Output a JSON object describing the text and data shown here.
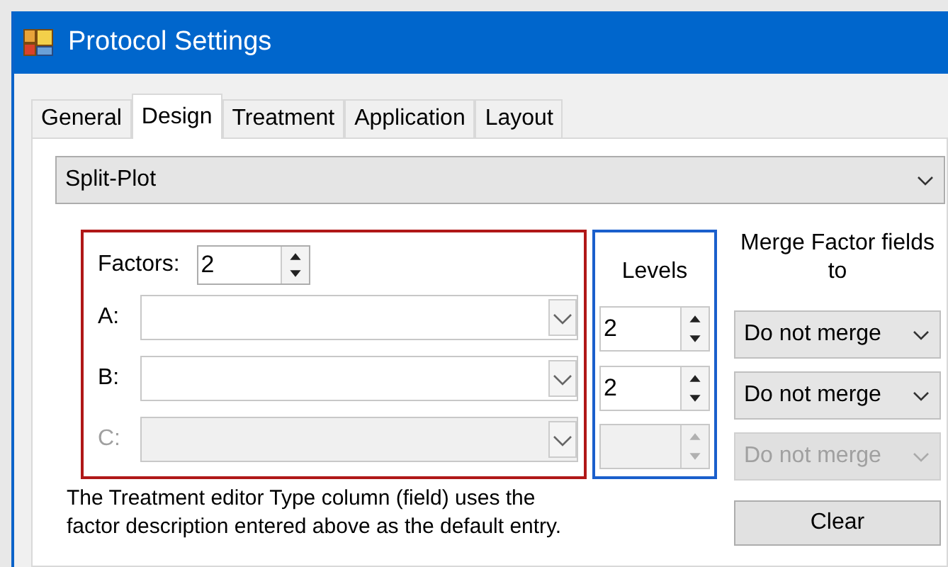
{
  "window": {
    "title": "Protocol Settings"
  },
  "tabs": [
    {
      "label": "General",
      "selected": false
    },
    {
      "label": "Design",
      "selected": true
    },
    {
      "label": "Treatment",
      "selected": false
    },
    {
      "label": "Application",
      "selected": false
    },
    {
      "label": "Layout",
      "selected": false
    }
  ],
  "design_type": {
    "value": "Split-Plot"
  },
  "factors": {
    "label": "Factors:",
    "value": "2"
  },
  "levels_heading": "Levels",
  "merge_heading": "Merge Factor fields to",
  "factor_rows": [
    {
      "label": "A:",
      "disabled": false,
      "level": "2",
      "merge": "Do not merge"
    },
    {
      "label": "B:",
      "disabled": false,
      "level": "2",
      "merge": "Do not merge"
    },
    {
      "label": "C:",
      "disabled": true,
      "merge": "Do not merge"
    }
  ],
  "note": "The Treatment editor Type column (field) uses the factor description entered above as the default entry.",
  "clear_button": "Clear"
}
